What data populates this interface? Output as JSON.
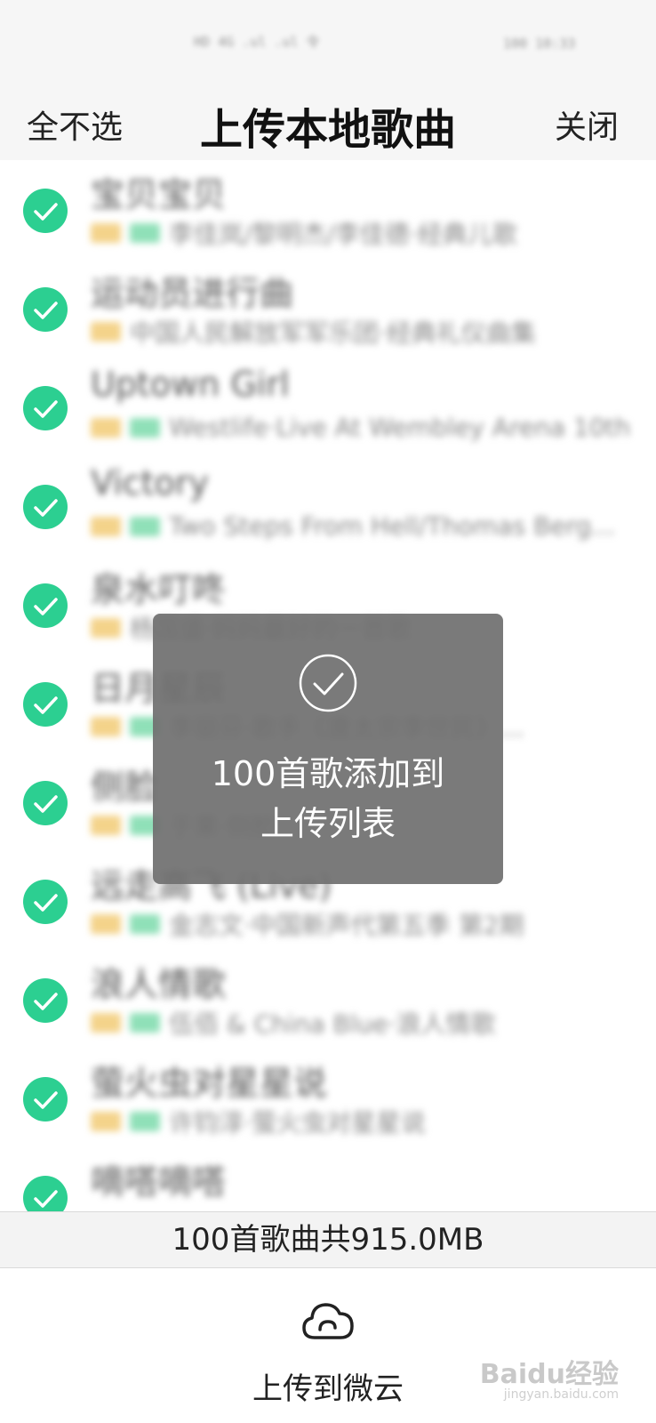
{
  "status_bar": {
    "left": "HD 4G .ul .ul 令",
    "right": "100 10:33"
  },
  "header": {
    "deselect_all": "全不选",
    "title": "上传本地歌曲",
    "close": "关闭"
  },
  "songs": [
    {
      "title": "宝贝宝贝",
      "artist": "李佳岚/黎明杰/李佳德·经典儿歌",
      "tags": [
        "sq",
        "hq"
      ]
    },
    {
      "title": "运动员进行曲",
      "artist": "中国人民解放军军乐团·经典礼仪曲集",
      "tags": [
        "sq"
      ]
    },
    {
      "title": "Uptown Girl",
      "artist": "Westlife·Live At Wembley Arena 10th...",
      "tags": [
        "sq",
        "hq"
      ]
    },
    {
      "title": "Victory",
      "artist": "Two Steps From Hell/Thomas Berg...",
      "tags": [
        "sq",
        "hq"
      ]
    },
    {
      "title": "泉水叮咚",
      "artist": "杨国盛·妈妈最好的一首歌",
      "tags": [
        "sq"
      ]
    },
    {
      "title": "日月星辰",
      "artist": "李丽芬·歌手《唐太宗李世民》...",
      "tags": [
        "sq",
        "hq"
      ]
    },
    {
      "title": "侧脸",
      "artist": "于果·侧脸",
      "tags": [
        "sq",
        "hq"
      ]
    },
    {
      "title": "远走高飞 (Live)",
      "artist": "金志文·中国新声代第五季 第2期",
      "tags": [
        "sq",
        "hq"
      ]
    },
    {
      "title": "浪人情歌",
      "artist": "伍佰 & China Blue·浪人情歌",
      "tags": [
        "sq",
        "hq"
      ]
    },
    {
      "title": "萤火虫对星星说",
      "artist": "许钧淳·萤火虫对星星说",
      "tags": [
        "sq",
        "hq"
      ]
    },
    {
      "title": "嘀嗒嘀嗒",
      "artist": "",
      "tags": []
    }
  ],
  "toast": {
    "line1": "100首歌添加到",
    "line2": "上传列表"
  },
  "summary": "100首歌曲共915.0MB",
  "bottom": {
    "upload_label": "上传到微云"
  },
  "watermark": {
    "brand": "Baidu经验",
    "url": "jingyan.baidu.com"
  },
  "colors": {
    "check_green": "#2ccf91",
    "sq_tag": "#f4d38a",
    "hq_tag": "#8fe0b8"
  }
}
